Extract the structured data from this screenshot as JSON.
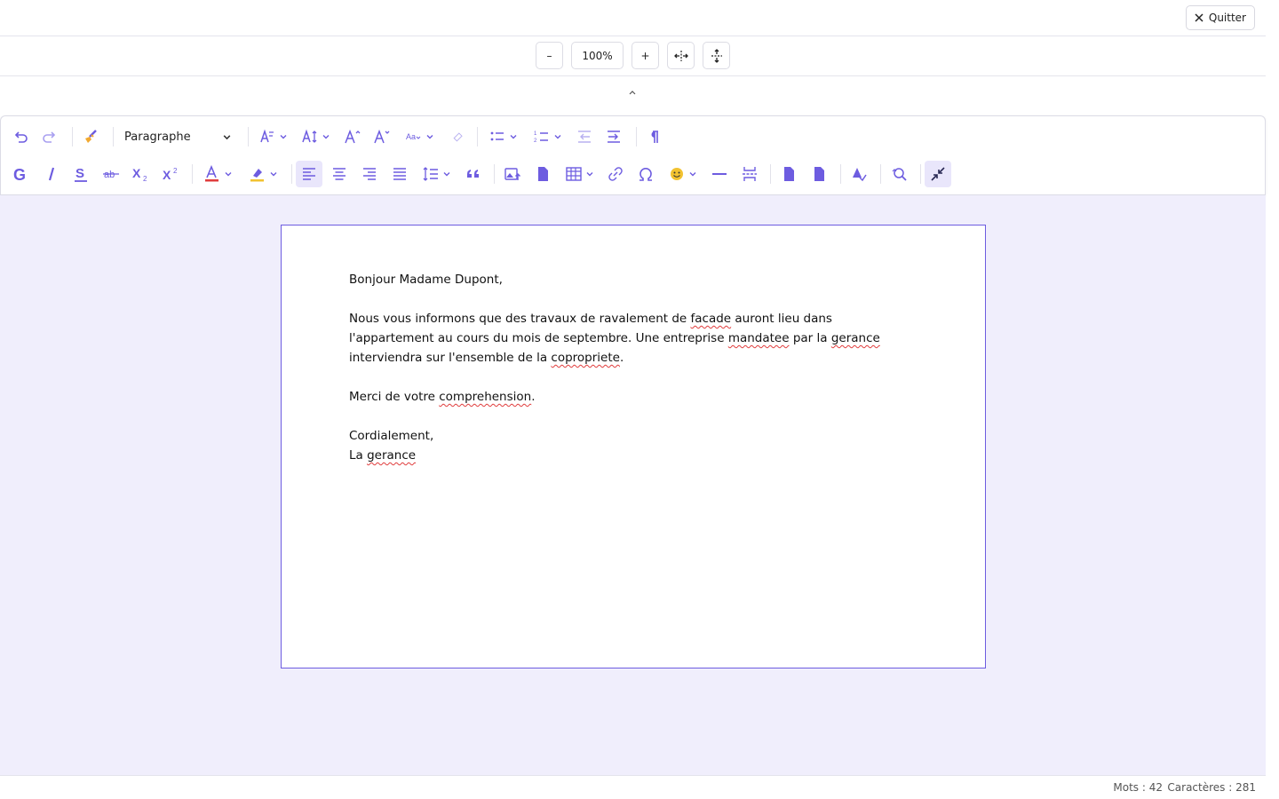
{
  "header": {
    "quit_label": "Quitter"
  },
  "zoom": {
    "minus_label": "–",
    "value": "100%",
    "plus_label": "+"
  },
  "toolbar": {
    "block_format": "Paragraphe"
  },
  "document": {
    "greeting": "Bonjour Madame Dupont,",
    "p1_a": "Nous vous informons que des travaux de ravalement de ",
    "p1_w1": "facade",
    "p1_b": " auront lieu dans l'appartement au cours du mois de septembre. Une entreprise ",
    "p1_w2": "mandatee",
    "p1_c": " par la ",
    "p1_w3": "gerance",
    "p1_d": " interviendra sur l'ensemble de la ",
    "p1_w4": "copropriete",
    "p1_e": ".",
    "p2_a": "Merci de votre ",
    "p2_w1": "comprehension",
    "p2_b": ".",
    "closing": "Cordialement,",
    "sign_a": "La ",
    "sign_w1": "gerance"
  },
  "status": {
    "words": "Mots : 42",
    "chars": "Caractères : 281"
  },
  "colors": {
    "accent": "#6d5ce0",
    "workspace": "#f0eefc",
    "text_color_underline": "#e03c3c",
    "highlight": "#f2c230"
  }
}
